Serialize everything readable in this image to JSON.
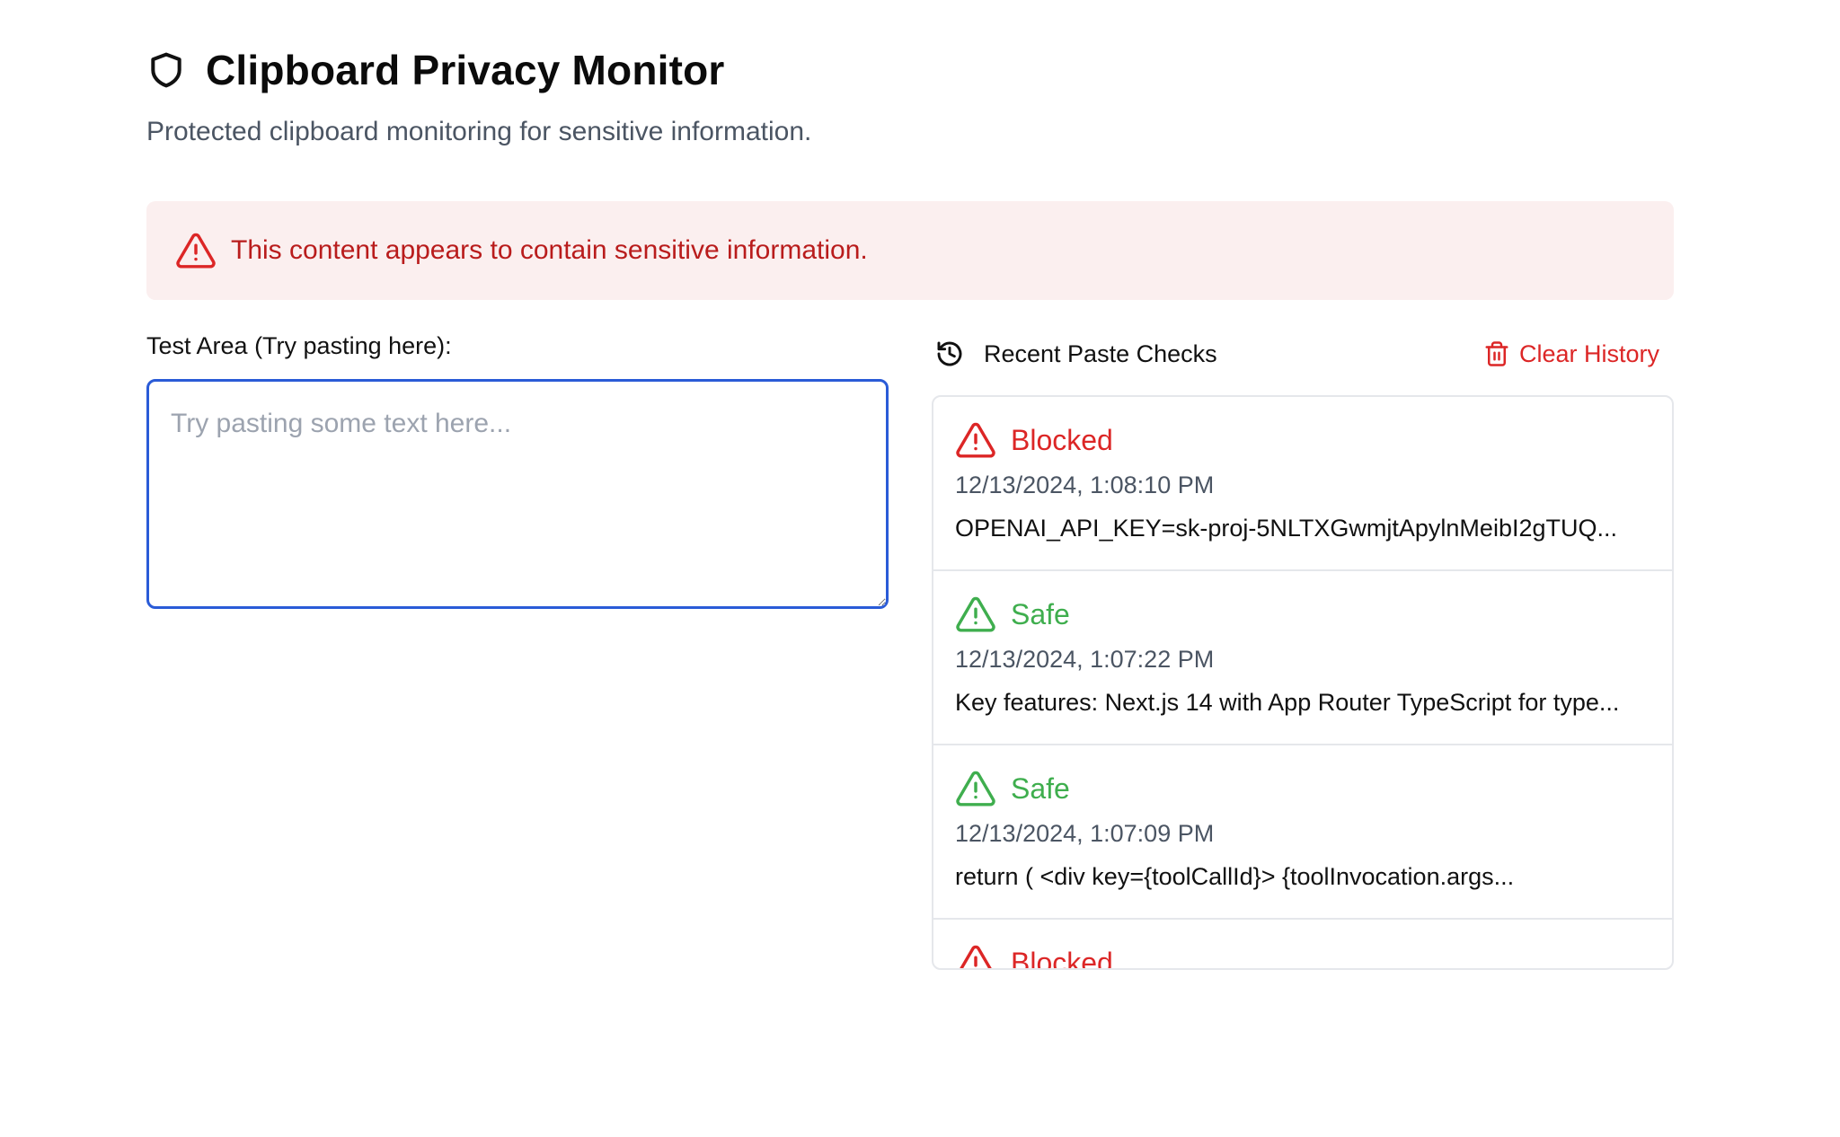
{
  "header": {
    "icon": "shield-icon",
    "title": "Clipboard Privacy Monitor",
    "subtitle": "Protected clipboard monitoring for sensitive information."
  },
  "alert": {
    "icon": "alert-triangle-icon",
    "message": "This content appears to contain sensitive information.",
    "colors": {
      "background": "#fbefef",
      "text": "#b91c1c"
    }
  },
  "test_area": {
    "label": "Test Area (Try pasting here):",
    "placeholder": "Try pasting some text here...",
    "value": ""
  },
  "history": {
    "icon": "history-icon",
    "title": "Recent Paste Checks",
    "clear_label": "Clear History",
    "clear_icon": "trash-icon",
    "entries": [
      {
        "status": "Blocked",
        "time": "12/13/2024, 1:08:10 PM",
        "content": "OPENAI_API_KEY=sk-proj-5NLTXGwmjtApylnMeibI2gTUQ..."
      },
      {
        "status": "Safe",
        "time": "12/13/2024, 1:07:22 PM",
        "content": "Key features: Next.js 14 with App Router TypeScript for type..."
      },
      {
        "status": "Safe",
        "time": "12/13/2024, 1:07:09 PM",
        "content": "return ( <div key={toolCallId}> {toolInvocation.args..."
      },
      {
        "status": "Blocked",
        "time": "",
        "content": ""
      }
    ]
  },
  "colors": {
    "accent": "#2a5bd7",
    "blocked": "#dc2626",
    "safe": "#3fae4e",
    "muted": "#4b5563"
  }
}
